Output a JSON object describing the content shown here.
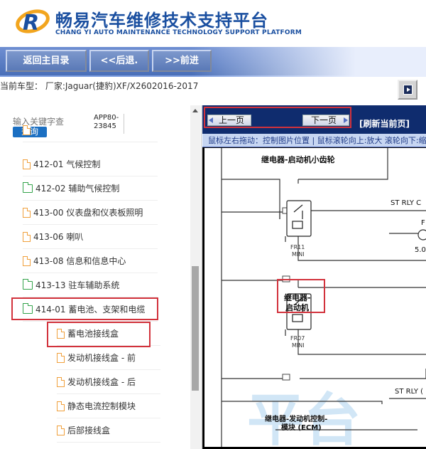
{
  "header": {
    "title_cn": "畅易汽车维修技术支持平台",
    "title_en": "CHANG YI AUTO MAINTENANCE TECHNOLOGY SUPPORT PLATFORM"
  },
  "nav": {
    "home": "返回主目录",
    "back": "<<后退.",
    "forward": ">>前进"
  },
  "vehicle": {
    "current": "当前车型： 厂家:Jaguar(捷豹)XF/X2602016-2017"
  },
  "search": {
    "placeholder": "输入关键字查",
    "button": "查询",
    "app_code_1": "APP80-",
    "app_code_2": "23845"
  },
  "tree": [
    {
      "label": "412-01 气候控制"
    },
    {
      "label": "412-02 辅助气候控制"
    },
    {
      "label": "413-00 仪表盘和仪表板照明"
    },
    {
      "label": "413-06 喇叭"
    },
    {
      "label": "413-08 信息和信息中心"
    },
    {
      "label": "413-13 驻车辅助系统"
    },
    {
      "label": "414-01 蓄电池、支架和电缆"
    },
    {
      "label": "蓄电池接线盒"
    },
    {
      "label": "发动机接线盒 - 前"
    },
    {
      "label": "发动机接线盒 - 后"
    },
    {
      "label": "静态电流控制模块"
    },
    {
      "label": "后部接线盒"
    }
  ],
  "viewer": {
    "prev": "上一页",
    "next": "下一页",
    "refresh": "[刷新当前页]",
    "hint": "鼠标左右拖动：控制图片位置 | 鼠标滚轮向上:放大   滚轮向下:缩小"
  },
  "diagram": {
    "relay1_title": "继电器-启动机小齿轮",
    "relay1_code": "FR11",
    "relay1_size": "MINI",
    "relay2_title_1": "继电器-",
    "relay2_title_2": "启动机",
    "relay2_code": "FR07",
    "relay2_size": "MINI",
    "relay3_title_1": "继电器-发动机控制-",
    "relay3_title_2": "模块 (ECM)",
    "label_st1": "ST RLY C",
    "label_st2": "ST RLY (",
    "label_f": "F",
    "label_5": "5.0",
    "watermark": "平台"
  },
  "colors": {
    "brand_blue": "#1a4fa0",
    "nav_blue": "#5a79b7",
    "highlight_red": "#d2323c",
    "pager_bg": "#0f2c6e"
  }
}
